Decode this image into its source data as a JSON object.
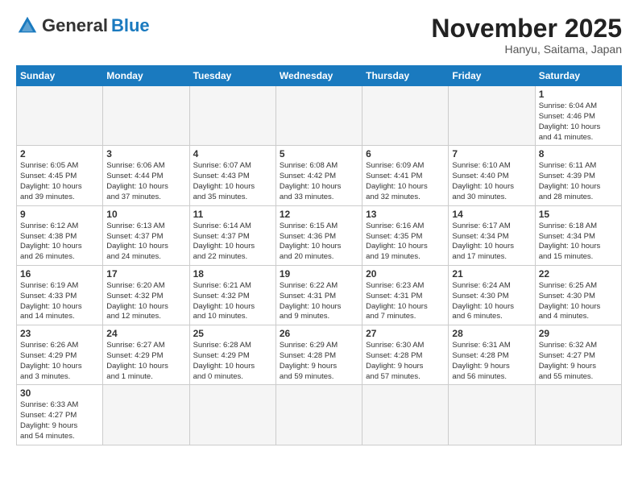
{
  "logo": {
    "text_general": "General",
    "text_blue": "Blue"
  },
  "title": "November 2025",
  "location": "Hanyu, Saitama, Japan",
  "weekdays": [
    "Sunday",
    "Monday",
    "Tuesday",
    "Wednesday",
    "Thursday",
    "Friday",
    "Saturday"
  ],
  "weeks": [
    [
      {
        "day": "",
        "info": ""
      },
      {
        "day": "",
        "info": ""
      },
      {
        "day": "",
        "info": ""
      },
      {
        "day": "",
        "info": ""
      },
      {
        "day": "",
        "info": ""
      },
      {
        "day": "",
        "info": ""
      },
      {
        "day": "1",
        "info": "Sunrise: 6:04 AM\nSunset: 4:46 PM\nDaylight: 10 hours\nand 41 minutes."
      }
    ],
    [
      {
        "day": "2",
        "info": "Sunrise: 6:05 AM\nSunset: 4:45 PM\nDaylight: 10 hours\nand 39 minutes."
      },
      {
        "day": "3",
        "info": "Sunrise: 6:06 AM\nSunset: 4:44 PM\nDaylight: 10 hours\nand 37 minutes."
      },
      {
        "day": "4",
        "info": "Sunrise: 6:07 AM\nSunset: 4:43 PM\nDaylight: 10 hours\nand 35 minutes."
      },
      {
        "day": "5",
        "info": "Sunrise: 6:08 AM\nSunset: 4:42 PM\nDaylight: 10 hours\nand 33 minutes."
      },
      {
        "day": "6",
        "info": "Sunrise: 6:09 AM\nSunset: 4:41 PM\nDaylight: 10 hours\nand 32 minutes."
      },
      {
        "day": "7",
        "info": "Sunrise: 6:10 AM\nSunset: 4:40 PM\nDaylight: 10 hours\nand 30 minutes."
      },
      {
        "day": "8",
        "info": "Sunrise: 6:11 AM\nSunset: 4:39 PM\nDaylight: 10 hours\nand 28 minutes."
      }
    ],
    [
      {
        "day": "9",
        "info": "Sunrise: 6:12 AM\nSunset: 4:38 PM\nDaylight: 10 hours\nand 26 minutes."
      },
      {
        "day": "10",
        "info": "Sunrise: 6:13 AM\nSunset: 4:37 PM\nDaylight: 10 hours\nand 24 minutes."
      },
      {
        "day": "11",
        "info": "Sunrise: 6:14 AM\nSunset: 4:37 PM\nDaylight: 10 hours\nand 22 minutes."
      },
      {
        "day": "12",
        "info": "Sunrise: 6:15 AM\nSunset: 4:36 PM\nDaylight: 10 hours\nand 20 minutes."
      },
      {
        "day": "13",
        "info": "Sunrise: 6:16 AM\nSunset: 4:35 PM\nDaylight: 10 hours\nand 19 minutes."
      },
      {
        "day": "14",
        "info": "Sunrise: 6:17 AM\nSunset: 4:34 PM\nDaylight: 10 hours\nand 17 minutes."
      },
      {
        "day": "15",
        "info": "Sunrise: 6:18 AM\nSunset: 4:34 PM\nDaylight: 10 hours\nand 15 minutes."
      }
    ],
    [
      {
        "day": "16",
        "info": "Sunrise: 6:19 AM\nSunset: 4:33 PM\nDaylight: 10 hours\nand 14 minutes."
      },
      {
        "day": "17",
        "info": "Sunrise: 6:20 AM\nSunset: 4:32 PM\nDaylight: 10 hours\nand 12 minutes."
      },
      {
        "day": "18",
        "info": "Sunrise: 6:21 AM\nSunset: 4:32 PM\nDaylight: 10 hours\nand 10 minutes."
      },
      {
        "day": "19",
        "info": "Sunrise: 6:22 AM\nSunset: 4:31 PM\nDaylight: 10 hours\nand 9 minutes."
      },
      {
        "day": "20",
        "info": "Sunrise: 6:23 AM\nSunset: 4:31 PM\nDaylight: 10 hours\nand 7 minutes."
      },
      {
        "day": "21",
        "info": "Sunrise: 6:24 AM\nSunset: 4:30 PM\nDaylight: 10 hours\nand 6 minutes."
      },
      {
        "day": "22",
        "info": "Sunrise: 6:25 AM\nSunset: 4:30 PM\nDaylight: 10 hours\nand 4 minutes."
      }
    ],
    [
      {
        "day": "23",
        "info": "Sunrise: 6:26 AM\nSunset: 4:29 PM\nDaylight: 10 hours\nand 3 minutes."
      },
      {
        "day": "24",
        "info": "Sunrise: 6:27 AM\nSunset: 4:29 PM\nDaylight: 10 hours\nand 1 minute."
      },
      {
        "day": "25",
        "info": "Sunrise: 6:28 AM\nSunset: 4:29 PM\nDaylight: 10 hours\nand 0 minutes."
      },
      {
        "day": "26",
        "info": "Sunrise: 6:29 AM\nSunset: 4:28 PM\nDaylight: 9 hours\nand 59 minutes."
      },
      {
        "day": "27",
        "info": "Sunrise: 6:30 AM\nSunset: 4:28 PM\nDaylight: 9 hours\nand 57 minutes."
      },
      {
        "day": "28",
        "info": "Sunrise: 6:31 AM\nSunset: 4:28 PM\nDaylight: 9 hours\nand 56 minutes."
      },
      {
        "day": "29",
        "info": "Sunrise: 6:32 AM\nSunset: 4:27 PM\nDaylight: 9 hours\nand 55 minutes."
      }
    ],
    [
      {
        "day": "30",
        "info": "Sunrise: 6:33 AM\nSunset: 4:27 PM\nDaylight: 9 hours\nand 54 minutes."
      },
      {
        "day": "",
        "info": ""
      },
      {
        "day": "",
        "info": ""
      },
      {
        "day": "",
        "info": ""
      },
      {
        "day": "",
        "info": ""
      },
      {
        "day": "",
        "info": ""
      },
      {
        "day": "",
        "info": ""
      }
    ]
  ]
}
